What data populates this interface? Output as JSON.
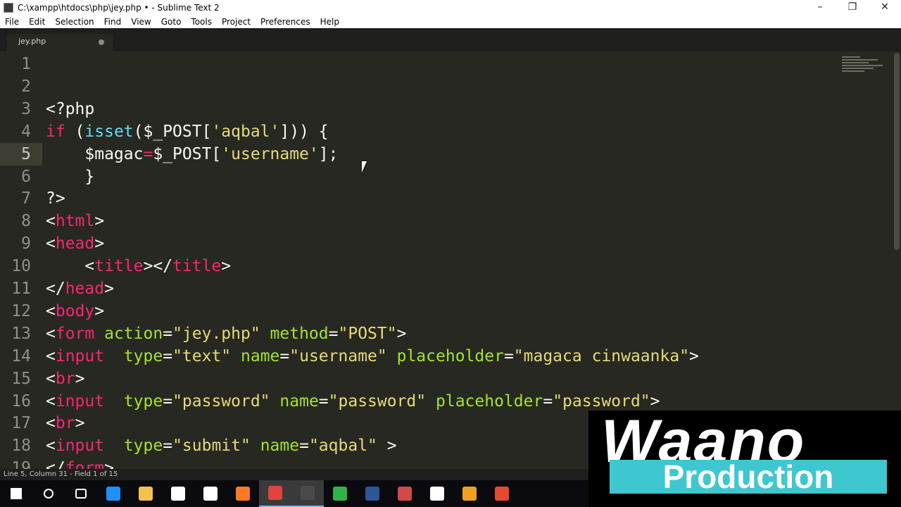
{
  "window": {
    "title": "C:\\xampp\\htdocs\\php\\jey.php • - Sublime Text 2",
    "controls": [
      "–",
      "❐",
      "✕"
    ]
  },
  "menu": [
    "File",
    "Edit",
    "Selection",
    "Find",
    "View",
    "Goto",
    "Tools",
    "Project",
    "Preferences",
    "Help"
  ],
  "tab": {
    "label": "jey.php",
    "modified": true
  },
  "current_line": 5,
  "colors": {
    "background": "#272822",
    "keyword": "#f92672",
    "string": "#e6db74",
    "function": "#66d9ef",
    "attribute": "#a6e22e",
    "plain": "#f8f8f2"
  },
  "lines": [
    [],
    [],
    [
      [
        "<?php",
        "p"
      ]
    ],
    [
      [
        "if",
        "k"
      ],
      [
        " (",
        "p"
      ],
      [
        "isset",
        "f"
      ],
      [
        "($_POST[",
        "p"
      ],
      [
        "'aqbal'",
        "s"
      ],
      [
        "])) {",
        "p"
      ]
    ],
    [
      [
        "    $magac",
        "p"
      ],
      [
        "=",
        "k"
      ],
      [
        "$_POST[",
        "p"
      ],
      [
        "'username'",
        "s"
      ],
      [
        "];",
        "p"
      ]
    ],
    [
      [
        "    }",
        "p"
      ]
    ],
    [
      [
        "?>",
        "p"
      ]
    ],
    [
      [
        "<",
        "p"
      ],
      [
        "html",
        "k"
      ],
      [
        ">",
        "p"
      ]
    ],
    [
      [
        "<",
        "p"
      ],
      [
        "head",
        "k"
      ],
      [
        ">",
        "p"
      ]
    ],
    [
      [
        "    <",
        "p"
      ],
      [
        "title",
        "k"
      ],
      [
        "></",
        "p"
      ],
      [
        "title",
        "k"
      ],
      [
        ">",
        "p"
      ]
    ],
    [
      [
        "</",
        "p"
      ],
      [
        "head",
        "k"
      ],
      [
        ">",
        "p"
      ]
    ],
    [
      [
        "<",
        "p"
      ],
      [
        "body",
        "k"
      ],
      [
        ">",
        "p"
      ]
    ],
    [
      [
        "<",
        "p"
      ],
      [
        "form",
        "k"
      ],
      [
        " ",
        "p"
      ],
      [
        "action",
        "a"
      ],
      [
        "=",
        "p"
      ],
      [
        "\"jey.php\"",
        "s"
      ],
      [
        " ",
        "p"
      ],
      [
        "method",
        "a"
      ],
      [
        "=",
        "p"
      ],
      [
        "\"POST\"",
        "s"
      ],
      [
        ">",
        "p"
      ]
    ],
    [
      [
        "<",
        "p"
      ],
      [
        "input",
        "k"
      ],
      [
        "  ",
        "p"
      ],
      [
        "type",
        "a"
      ],
      [
        "=",
        "p"
      ],
      [
        "\"text\"",
        "s"
      ],
      [
        " ",
        "p"
      ],
      [
        "name",
        "a"
      ],
      [
        "=",
        "p"
      ],
      [
        "\"username\"",
        "s"
      ],
      [
        " ",
        "p"
      ],
      [
        "placeholder",
        "a"
      ],
      [
        "=",
        "p"
      ],
      [
        "\"magaca cinwaanka\"",
        "s"
      ],
      [
        ">",
        "p"
      ]
    ],
    [
      [
        "<",
        "p"
      ],
      [
        "br",
        "k"
      ],
      [
        ">",
        "p"
      ]
    ],
    [
      [
        "<",
        "p"
      ],
      [
        "input",
        "k"
      ],
      [
        "  ",
        "p"
      ],
      [
        "type",
        "a"
      ],
      [
        "=",
        "p"
      ],
      [
        "\"password\"",
        "s"
      ],
      [
        " ",
        "p"
      ],
      [
        "name",
        "a"
      ],
      [
        "=",
        "p"
      ],
      [
        "\"password\"",
        "s"
      ],
      [
        " ",
        "p"
      ],
      [
        "placeholder",
        "a"
      ],
      [
        "=",
        "p"
      ],
      [
        "\"password\"",
        "s"
      ],
      [
        ">",
        "p"
      ]
    ],
    [
      [
        "<",
        "p"
      ],
      [
        "br",
        "k"
      ],
      [
        ">",
        "p"
      ]
    ],
    [
      [
        "<",
        "p"
      ],
      [
        "input",
        "k"
      ],
      [
        "  ",
        "p"
      ],
      [
        "type",
        "a"
      ],
      [
        "=",
        "p"
      ],
      [
        "\"submit\"",
        "s"
      ],
      [
        " ",
        "p"
      ],
      [
        "name",
        "a"
      ],
      [
        "=",
        "p"
      ],
      [
        "\"aqbal\"",
        "s"
      ],
      [
        " >",
        "p"
      ]
    ],
    [
      [
        "</",
        "p"
      ],
      [
        "form",
        "k"
      ],
      [
        ">",
        "p"
      ]
    ]
  ],
  "status": "Line 5, Column 31 - Field 1 of 15",
  "watermark": {
    "line1": "Waano",
    "line2": "Production"
  },
  "taskbar": [
    {
      "name": "start-icon",
      "color": "#ffffff"
    },
    {
      "name": "search-icon",
      "color": "#ffffff"
    },
    {
      "name": "task-view-icon",
      "color": "#ffffff"
    },
    {
      "name": "edge-icon",
      "color": "#1e90ff"
    },
    {
      "name": "file-explorer-icon",
      "color": "#f2c14e"
    },
    {
      "name": "store-icon",
      "color": "#ffffff"
    },
    {
      "name": "mail-icon",
      "color": "#ffffff"
    },
    {
      "name": "xampp-icon",
      "color": "#fb7a24"
    },
    {
      "name": "chrome-icon",
      "color": "#e0443c",
      "active": true
    },
    {
      "name": "sublime-icon",
      "color": "#4a4a4a",
      "active": true
    },
    {
      "name": "camtasia-icon",
      "color": "#2fb34a"
    },
    {
      "name": "word-icon",
      "color": "#2b5797"
    },
    {
      "name": "app-icon",
      "color": "#d04a4a"
    },
    {
      "name": "video-editor-icon",
      "color": "#ffffff"
    },
    {
      "name": "obs-icon",
      "color": "#f0a020"
    },
    {
      "name": "codeigniter-icon",
      "color": "#e64a2e"
    }
  ]
}
